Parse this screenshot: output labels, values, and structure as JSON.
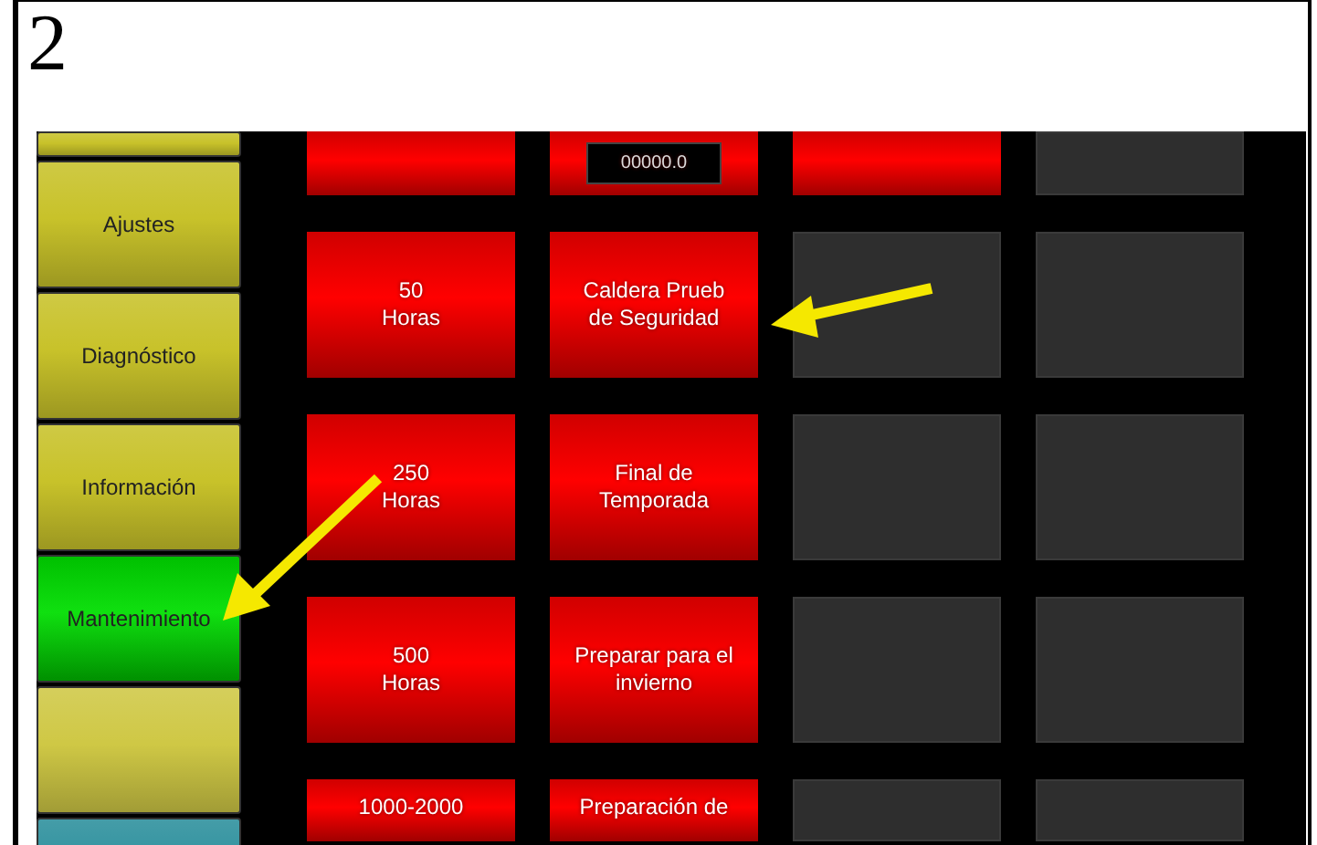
{
  "figure_number": "2",
  "sidebar": {
    "items": [
      {
        "selected": false,
        "color": "#c8c22a"
      },
      {
        "label": "Ajustes",
        "selected": false,
        "color": "#c8c22a"
      },
      {
        "label": "Diagnóstico",
        "selected": false,
        "color": "#c8c22a"
      },
      {
        "label": "Información",
        "selected": false,
        "color": "#c8c22a"
      },
      {
        "label": "Mantenimiento",
        "selected": true
      },
      {
        "selected": false,
        "color": "#cfc845"
      },
      {
        "selected": false,
        "color": "#2b8f9c"
      }
    ]
  },
  "grid": {
    "rows": [
      {
        "tiles": [
          {
            "kind": "action"
          },
          {
            "kind": "readout",
            "value": "00000.0"
          },
          {
            "kind": "action"
          },
          {
            "kind": "blank"
          }
        ]
      },
      {
        "tiles": [
          {
            "kind": "action",
            "lines": [
              "50",
              "Horas"
            ]
          },
          {
            "kind": "action",
            "lines": [
              "Caldera Prueb",
              "de Seguridad"
            ]
          },
          {
            "kind": "blank"
          },
          {
            "kind": "blank"
          }
        ]
      },
      {
        "tiles": [
          {
            "kind": "action",
            "lines": [
              "250",
              "Horas"
            ]
          },
          {
            "kind": "action",
            "lines": [
              "Final de",
              "Temporada"
            ]
          },
          {
            "kind": "blank"
          },
          {
            "kind": "blank"
          }
        ]
      },
      {
        "tiles": [
          {
            "kind": "action",
            "lines": [
              "500",
              "Horas"
            ]
          },
          {
            "kind": "action",
            "lines": [
              "Preparar para el",
              "invierno"
            ]
          },
          {
            "kind": "blank"
          },
          {
            "kind": "blank"
          }
        ]
      },
      {
        "tiles": [
          {
            "kind": "action",
            "lines": [
              "1000-2000"
            ]
          },
          {
            "kind": "action",
            "lines": [
              "Preparación de"
            ]
          },
          {
            "kind": "blank"
          },
          {
            "kind": "blank"
          }
        ]
      }
    ]
  }
}
